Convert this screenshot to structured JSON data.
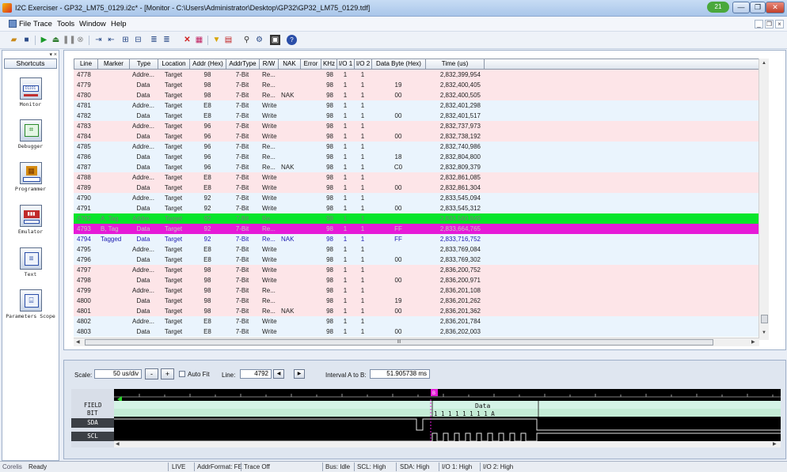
{
  "window": {
    "title": "I2C Exerciser - GP32_LM75_0129.i2c* - [Monitor - C:\\Users\\Administrator\\Desktop\\GP32\\GP32_LM75_0129.tdf]",
    "badge": "21",
    "minimize": "—",
    "restore": "❐",
    "close": "✕"
  },
  "menu": {
    "items": [
      "File",
      "Trace",
      "Tools",
      "Window",
      "Help"
    ],
    "mdi_controls": [
      "_",
      "❐",
      "×"
    ]
  },
  "toolbar": {
    "icons": [
      "open-icon",
      "save-icon",
      "run-icon",
      "upload-icon",
      "pause-icon",
      "stop-icon",
      "step-icon",
      "step-back-icon",
      "zoom-in-icon",
      "zoom-out-icon",
      "align-left-icon",
      "align-right-icon",
      "delete-icon",
      "grid-icon",
      "filter-icon",
      "chart-icon",
      "find-icon",
      "settings-icon",
      "view-icon",
      "help-icon"
    ]
  },
  "shortcuts": {
    "title": "Shortcuts",
    "pin": "▾ ×",
    "items": [
      {
        "label": "Monitor",
        "glyph": "01101",
        "icon": "monitor-icon"
      },
      {
        "label": "Debugger",
        "glyph": "⌗",
        "icon": "debugger-icon"
      },
      {
        "label": "Programmer",
        "glyph": "▦",
        "icon": "programmer-icon"
      },
      {
        "label": "Emulator",
        "glyph": "▮▮▮",
        "icon": "emulator-icon"
      },
      {
        "label": "Text",
        "glyph": "≡",
        "icon": "text-icon"
      },
      {
        "label": "Parameters Scope",
        "glyph": "⌸",
        "icon": "parameters-scope-icon"
      }
    ]
  },
  "table": {
    "columns": [
      "Line",
      "Marker",
      "Type",
      "Location",
      "Addr (Hex)",
      "AddrType",
      "R/W",
      "NAK",
      "Error",
      "KHz",
      "I/O 1",
      "I/O 2",
      "Data Byte (Hex)",
      "Time (us)"
    ],
    "rows": [
      {
        "line": "4778",
        "marker": "",
        "type": "Addre...",
        "location": "Target",
        "addr": "98",
        "addrtype": "7-Bit",
        "rw": "Re...",
        "nak": "",
        "error": "",
        "khz": "98",
        "io1": "1",
        "io2": "1",
        "data": "",
        "time": "2,832,399,954",
        "style": "r-pink"
      },
      {
        "line": "4779",
        "marker": "",
        "type": "Data",
        "location": "Target",
        "addr": "98",
        "addrtype": "7-Bit",
        "rw": "Re...",
        "nak": "",
        "error": "",
        "khz": "98",
        "io1": "1",
        "io2": "1",
        "data": "19",
        "time": "2,832,400,405",
        "style": "r-pink"
      },
      {
        "line": "4780",
        "marker": "",
        "type": "Data",
        "location": "Target",
        "addr": "98",
        "addrtype": "7-Bit",
        "rw": "Re...",
        "nak": "NAK",
        "error": "",
        "khz": "98",
        "io1": "1",
        "io2": "1",
        "data": "00",
        "time": "2,832,400,505",
        "style": "r-pink"
      },
      {
        "line": "4781",
        "marker": "",
        "type": "Addre...",
        "location": "Target",
        "addr": "E8",
        "addrtype": "7-Bit",
        "rw": "Write",
        "nak": "",
        "error": "",
        "khz": "98",
        "io1": "1",
        "io2": "1",
        "data": "",
        "time": "2,832,401,298",
        "style": "r-blue"
      },
      {
        "line": "4782",
        "marker": "",
        "type": "Data",
        "location": "Target",
        "addr": "E8",
        "addrtype": "7-Bit",
        "rw": "Write",
        "nak": "",
        "error": "",
        "khz": "98",
        "io1": "1",
        "io2": "1",
        "data": "00",
        "time": "2,832,401,517",
        "style": "r-blue"
      },
      {
        "line": "4783",
        "marker": "",
        "type": "Addre...",
        "location": "Target",
        "addr": "96",
        "addrtype": "7-Bit",
        "rw": "Write",
        "nak": "",
        "error": "",
        "khz": "98",
        "io1": "1",
        "io2": "1",
        "data": "",
        "time": "2,832,737,973",
        "style": "r-pink"
      },
      {
        "line": "4784",
        "marker": "",
        "type": "Data",
        "location": "Target",
        "addr": "96",
        "addrtype": "7-Bit",
        "rw": "Write",
        "nak": "",
        "error": "",
        "khz": "98",
        "io1": "1",
        "io2": "1",
        "data": "00",
        "time": "2,832,738,192",
        "style": "r-pink"
      },
      {
        "line": "4785",
        "marker": "",
        "type": "Addre...",
        "location": "Target",
        "addr": "96",
        "addrtype": "7-Bit",
        "rw": "Re...",
        "nak": "",
        "error": "",
        "khz": "98",
        "io1": "1",
        "io2": "1",
        "data": "",
        "time": "2,832,740,986",
        "style": "r-blue"
      },
      {
        "line": "4786",
        "marker": "",
        "type": "Data",
        "location": "Target",
        "addr": "96",
        "addrtype": "7-Bit",
        "rw": "Re...",
        "nak": "",
        "error": "",
        "khz": "98",
        "io1": "1",
        "io2": "1",
        "data": "18",
        "time": "2,832,804,800",
        "style": "r-blue"
      },
      {
        "line": "4787",
        "marker": "",
        "type": "Data",
        "location": "Target",
        "addr": "96",
        "addrtype": "7-Bit",
        "rw": "Re...",
        "nak": "NAK",
        "error": "",
        "khz": "98",
        "io1": "1",
        "io2": "1",
        "data": "C0",
        "time": "2,832,809,379",
        "style": "r-blue"
      },
      {
        "line": "4788",
        "marker": "",
        "type": "Addre...",
        "location": "Target",
        "addr": "E8",
        "addrtype": "7-Bit",
        "rw": "Write",
        "nak": "",
        "error": "",
        "khz": "98",
        "io1": "1",
        "io2": "1",
        "data": "",
        "time": "2,832,861,085",
        "style": "r-pink"
      },
      {
        "line": "4789",
        "marker": "",
        "type": "Data",
        "location": "Target",
        "addr": "E8",
        "addrtype": "7-Bit",
        "rw": "Write",
        "nak": "",
        "error": "",
        "khz": "98",
        "io1": "1",
        "io2": "1",
        "data": "00",
        "time": "2,832,861,304",
        "style": "r-pink"
      },
      {
        "line": "4790",
        "marker": "",
        "type": "Addre...",
        "location": "Target",
        "addr": "92",
        "addrtype": "7-Bit",
        "rw": "Write",
        "nak": "",
        "error": "",
        "khz": "98",
        "io1": "1",
        "io2": "1",
        "data": "",
        "time": "2,833,545,094",
        "style": "r-blue"
      },
      {
        "line": "4791",
        "marker": "",
        "type": "Data",
        "location": "Target",
        "addr": "92",
        "addrtype": "7-Bit",
        "rw": "Write",
        "nak": "",
        "error": "",
        "khz": "98",
        "io1": "1",
        "io2": "1",
        "data": "00",
        "time": "2,833,545,312",
        "style": "r-blue"
      },
      {
        "line": "4792",
        "marker": "A, Tag",
        "type": "Addre...",
        "location": "Target",
        "addr": "92",
        "addrtype": "7-Bit",
        "rw": "Re...",
        "nak": "",
        "error": "",
        "khz": "98",
        "io1": "1",
        "io2": "1",
        "data": "",
        "time": "2,833,560,849",
        "style": "r-green"
      },
      {
        "line": "4793",
        "marker": "B, Tag",
        "type": "Data",
        "location": "Target",
        "addr": "92",
        "addrtype": "7-Bit",
        "rw": "Re...",
        "nak": "",
        "error": "",
        "khz": "98",
        "io1": "1",
        "io2": "1",
        "data": "FF",
        "time": "2,833,664,765",
        "style": "r-mag"
      },
      {
        "line": "4794",
        "marker": "Tagged",
        "type": "Data",
        "location": "Target",
        "addr": "92",
        "addrtype": "7-Bit",
        "rw": "Re...",
        "nak": "NAK",
        "error": "",
        "khz": "98",
        "io1": "1",
        "io2": "1",
        "data": "FF",
        "time": "2,833,716,752",
        "style": "r-blue r-tag"
      },
      {
        "line": "4795",
        "marker": "",
        "type": "Addre...",
        "location": "Target",
        "addr": "E8",
        "addrtype": "7-Bit",
        "rw": "Write",
        "nak": "",
        "error": "",
        "khz": "98",
        "io1": "1",
        "io2": "1",
        "data": "",
        "time": "2,833,769,084",
        "style": "r-blue"
      },
      {
        "line": "4796",
        "marker": "",
        "type": "Data",
        "location": "Target",
        "addr": "E8",
        "addrtype": "7-Bit",
        "rw": "Write",
        "nak": "",
        "error": "",
        "khz": "98",
        "io1": "1",
        "io2": "1",
        "data": "00",
        "time": "2,833,769,302",
        "style": "r-blue"
      },
      {
        "line": "4797",
        "marker": "",
        "type": "Addre...",
        "location": "Target",
        "addr": "98",
        "addrtype": "7-Bit",
        "rw": "Write",
        "nak": "",
        "error": "",
        "khz": "98",
        "io1": "1",
        "io2": "1",
        "data": "",
        "time": "2,836,200,752",
        "style": "r-pink"
      },
      {
        "line": "4798",
        "marker": "",
        "type": "Data",
        "location": "Target",
        "addr": "98",
        "addrtype": "7-Bit",
        "rw": "Write",
        "nak": "",
        "error": "",
        "khz": "98",
        "io1": "1",
        "io2": "1",
        "data": "00",
        "time": "2,836,200,971",
        "style": "r-pink"
      },
      {
        "line": "4799",
        "marker": "",
        "type": "Addre...",
        "location": "Target",
        "addr": "98",
        "addrtype": "7-Bit",
        "rw": "Re...",
        "nak": "",
        "error": "",
        "khz": "98",
        "io1": "1",
        "io2": "1",
        "data": "",
        "time": "2,836,201,108",
        "style": "r-pink"
      },
      {
        "line": "4800",
        "marker": "",
        "type": "Data",
        "location": "Target",
        "addr": "98",
        "addrtype": "7-Bit",
        "rw": "Re...",
        "nak": "",
        "error": "",
        "khz": "98",
        "io1": "1",
        "io2": "1",
        "data": "19",
        "time": "2,836,201,262",
        "style": "r-pink"
      },
      {
        "line": "4801",
        "marker": "",
        "type": "Data",
        "location": "Target",
        "addr": "98",
        "addrtype": "7-Bit",
        "rw": "Re...",
        "nak": "NAK",
        "error": "",
        "khz": "98",
        "io1": "1",
        "io2": "1",
        "data": "00",
        "time": "2,836,201,362",
        "style": "r-pink"
      },
      {
        "line": "4802",
        "marker": "",
        "type": "Addre...",
        "location": "Target",
        "addr": "E8",
        "addrtype": "7-Bit",
        "rw": "Write",
        "nak": "",
        "error": "",
        "khz": "98",
        "io1": "1",
        "io2": "1",
        "data": "",
        "time": "2,836,201,784",
        "style": "r-blue"
      },
      {
        "line": "4803",
        "marker": "",
        "type": "Data",
        "location": "Target",
        "addr": "E8",
        "addrtype": "7-Bit",
        "rw": "Write",
        "nak": "",
        "error": "",
        "khz": "98",
        "io1": "1",
        "io2": "1",
        "data": "00",
        "time": "2,836,202,003",
        "style": "r-blue"
      }
    ],
    "hscroll_label": "III"
  },
  "waveform": {
    "scale_label": "Scale:",
    "scale_value": "50 us/div",
    "minus": "-",
    "plus": "+",
    "autofit_label": "Auto Fit",
    "line_label": "Line:",
    "line_value": "4792",
    "interval_label": "Interval A to B:",
    "interval_value": "51.905738 ms",
    "marker_b": "B",
    "field_label": "FIELD",
    "bit_label": "BIT",
    "field_value": "Data",
    "bits": "1 1 1 1 1 1 1 1 A",
    "signals": [
      "SDA",
      "SCL"
    ]
  },
  "statusbar": {
    "logo": "Corelis",
    "ready": "Ready",
    "live": "LIVE",
    "addr_format": "AddrFormat: FE",
    "trace": "Trace Off",
    "bus": "Bus: Idle",
    "scl": "SCL: High",
    "sda": "SDA: High",
    "io1": "I/O 1: High",
    "io2": "I/O 2: High"
  }
}
